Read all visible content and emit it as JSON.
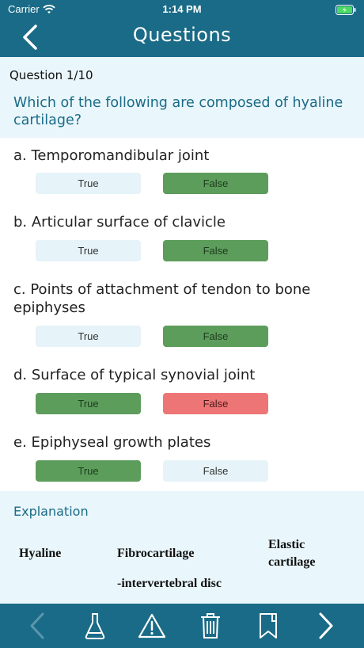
{
  "status": {
    "carrier": "Carrier",
    "time": "1:14 PM"
  },
  "nav": {
    "title": "Questions"
  },
  "question": {
    "counter": "Question 1/10",
    "text": "Which of the following are composed of hyaline cartilage?"
  },
  "buttons": {
    "true_label": "True",
    "false_label": "False"
  },
  "options": [
    {
      "text": "a. Temporomandibular joint",
      "true_state": "neutral",
      "false_state": "correct"
    },
    {
      "text": "b. Articular surface of clavicle",
      "true_state": "neutral",
      "false_state": "correct"
    },
    {
      "text": "c. Points of attachment of tendon to bone epiphyses",
      "true_state": "neutral",
      "false_state": "correct"
    },
    {
      "text": "d. Surface of typical synovial joint",
      "true_state": "correct",
      "false_state": "wrong"
    },
    {
      "text": "e. Epiphyseal growth plates",
      "true_state": "correct",
      "false_state": "neutral"
    }
  ],
  "explanation": {
    "title": "Explanation",
    "col1": "Hyaline",
    "col2": "Fibrocartilage",
    "col3": "Elastic cartilage",
    "col2_item": "-intervertebral disc"
  },
  "colors": {
    "header": "#1a6b87",
    "neutral_button": "#e6f3f9",
    "correct_button": "#5d9d5c",
    "wrong_button": "#ee7575",
    "toolbar_icons": "#5a97ad"
  },
  "toolbar": {
    "icons": [
      "chevron-left-icon",
      "flask-icon",
      "warning-icon",
      "trash-icon",
      "bookmark-icon",
      "chevron-right-icon"
    ]
  }
}
